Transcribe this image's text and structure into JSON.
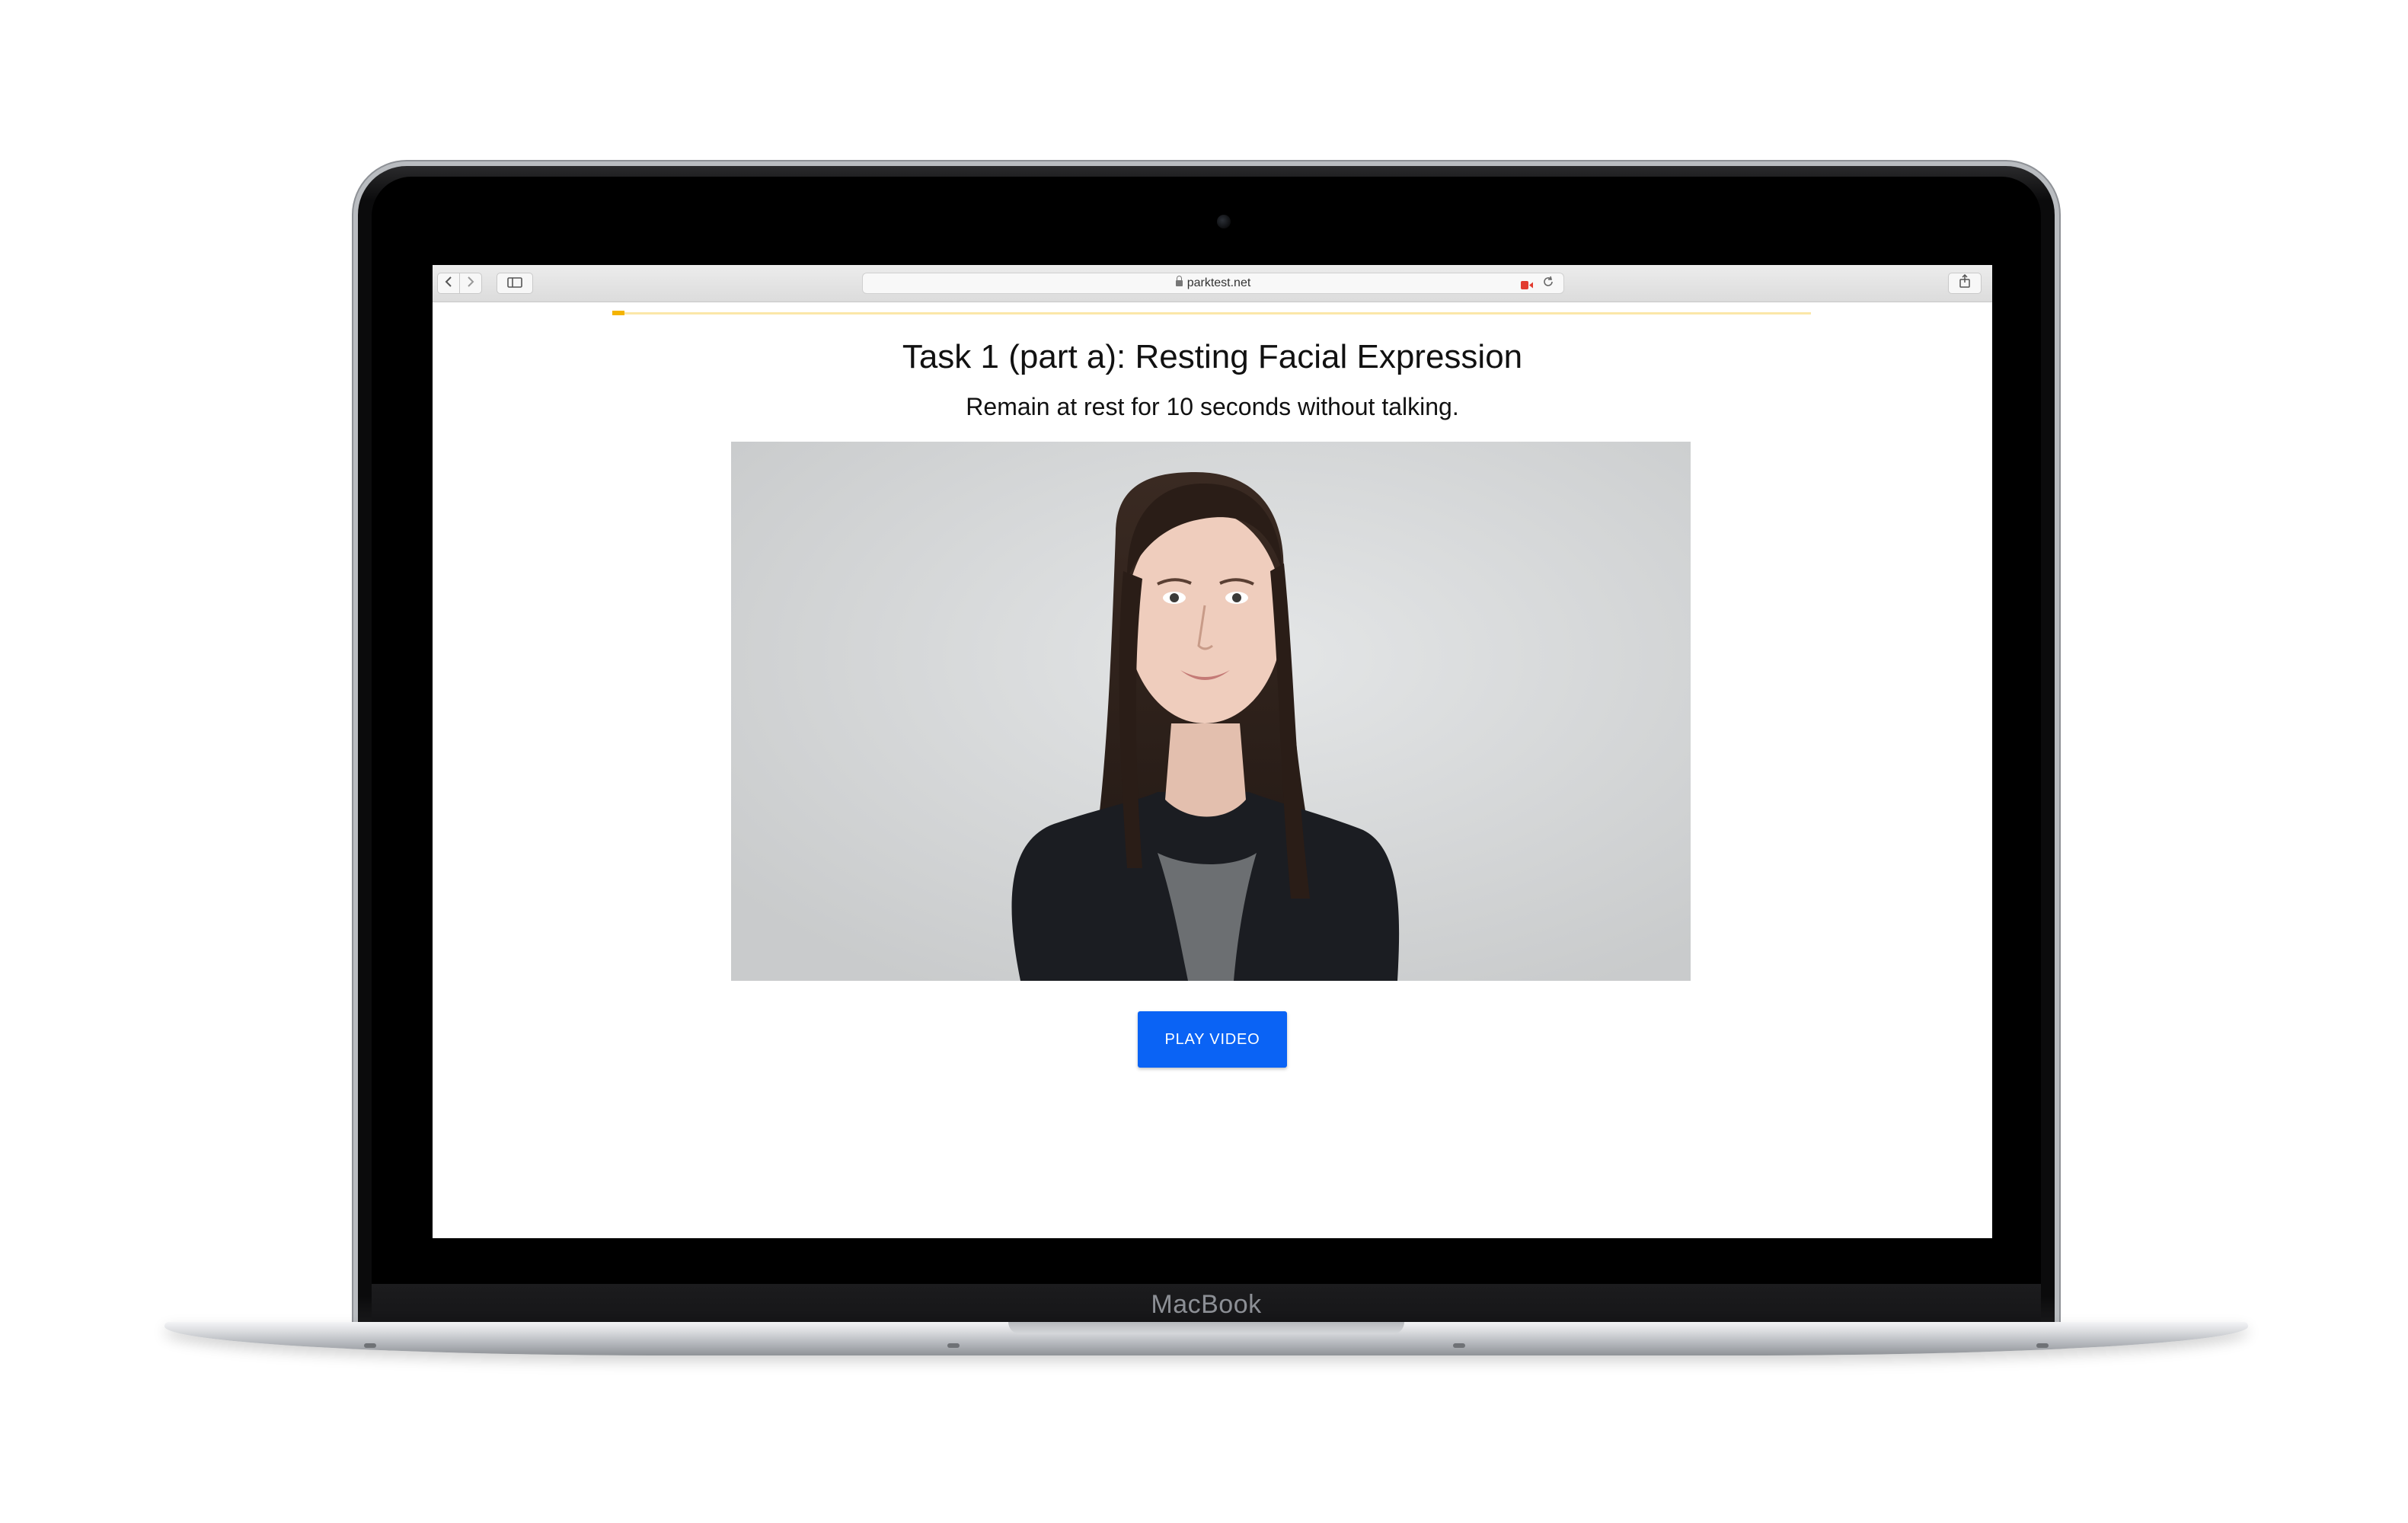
{
  "device": {
    "brand_label": "MacBook"
  },
  "browser": {
    "url": "parktest.net",
    "icons": {
      "back": "chevron-left-icon",
      "forward": "chevron-right-icon",
      "sidebar": "sidebar-icon",
      "lock": "lock-icon",
      "recording": "camera-recording-icon",
      "reload": "reload-icon",
      "share": "share-icon"
    }
  },
  "page": {
    "progress": 0.01,
    "title": "Task 1 (part a): Resting Facial Expression",
    "instruction": "Remain at rest for 10 seconds without talking.",
    "play_button_label": "PLAY VIDEO",
    "colors": {
      "accent": "#0a63f5",
      "progress": "#f4b400",
      "recording": "#e23a2e"
    }
  }
}
